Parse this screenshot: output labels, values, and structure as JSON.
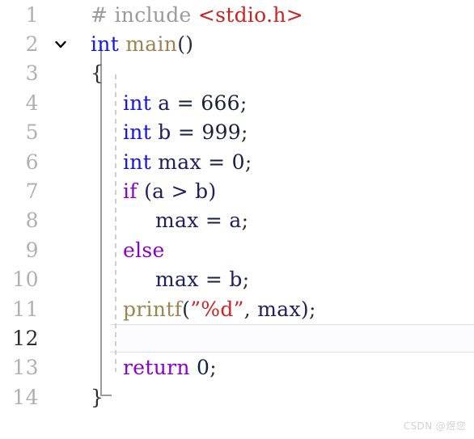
{
  "editor": {
    "language": "c",
    "background_color": "#ffffff",
    "active_line": 12,
    "fold_marker": {
      "line": 2,
      "state": "expanded",
      "icon": "chevron-down-icon"
    },
    "colors": {
      "line_number": "#b0b0b0",
      "line_number_active": "#2b2b38",
      "preprocessor": "#9a9a9a",
      "header_name": "#cc2222",
      "keyword_type": "#1414e6",
      "keyword_control": "#8b00c8",
      "function_name": "#9c8452",
      "identifier": "#1e2060",
      "number": "#16213e",
      "string": "#cc2222",
      "punctuation": "#2b2b38",
      "fold_line": "#9b9b9b",
      "indent_guide": "#cfcfcf",
      "active_line_border": "#dcdce6"
    },
    "lines": [
      {
        "number": "1",
        "indent": 0,
        "tokens": [
          {
            "text": "# include ",
            "type": "pre"
          },
          {
            "text": "<stdio.h>",
            "type": "header"
          }
        ]
      },
      {
        "number": "2",
        "indent": 0,
        "tokens": [
          {
            "text": "int",
            "type": "kw"
          },
          {
            "text": " ",
            "type": "punc"
          },
          {
            "text": "main",
            "type": "fn"
          },
          {
            "text": "()",
            "type": "punc"
          }
        ]
      },
      {
        "number": "3",
        "indent": 0,
        "tokens": [
          {
            "text": "{",
            "type": "punc"
          }
        ]
      },
      {
        "number": "4",
        "indent": 1,
        "tokens": [
          {
            "text": "int",
            "type": "kw"
          },
          {
            "text": " ",
            "type": "punc"
          },
          {
            "text": "a",
            "type": "ident"
          },
          {
            "text": " ",
            "type": "punc"
          },
          {
            "text": "=",
            "type": "op"
          },
          {
            "text": " ",
            "type": "punc"
          },
          {
            "text": "666",
            "type": "num"
          },
          {
            "text": ";",
            "type": "punc"
          }
        ]
      },
      {
        "number": "5",
        "indent": 1,
        "tokens": [
          {
            "text": "int",
            "type": "kw"
          },
          {
            "text": " ",
            "type": "punc"
          },
          {
            "text": "b",
            "type": "ident"
          },
          {
            "text": " ",
            "type": "punc"
          },
          {
            "text": "=",
            "type": "op"
          },
          {
            "text": " ",
            "type": "punc"
          },
          {
            "text": "999",
            "type": "num"
          },
          {
            "text": ";",
            "type": "punc"
          }
        ]
      },
      {
        "number": "6",
        "indent": 1,
        "tokens": [
          {
            "text": "int",
            "type": "kw"
          },
          {
            "text": " ",
            "type": "punc"
          },
          {
            "text": "max",
            "type": "ident"
          },
          {
            "text": " ",
            "type": "punc"
          },
          {
            "text": "=",
            "type": "op"
          },
          {
            "text": " ",
            "type": "punc"
          },
          {
            "text": "0",
            "type": "num"
          },
          {
            "text": ";",
            "type": "punc"
          }
        ]
      },
      {
        "number": "7",
        "indent": 1,
        "tokens": [
          {
            "text": "if",
            "type": "ctrl"
          },
          {
            "text": " ",
            "type": "punc"
          },
          {
            "text": "(",
            "type": "ident"
          },
          {
            "text": "a",
            "type": "ident"
          },
          {
            "text": " ",
            "type": "punc"
          },
          {
            "text": ">",
            "type": "ident"
          },
          {
            "text": " ",
            "type": "punc"
          },
          {
            "text": "b",
            "type": "ident"
          },
          {
            "text": ")",
            "type": "ident"
          }
        ]
      },
      {
        "number": "8",
        "indent": 2,
        "tokens": [
          {
            "text": "max",
            "type": "ident"
          },
          {
            "text": " ",
            "type": "punc"
          },
          {
            "text": "=",
            "type": "op"
          },
          {
            "text": " ",
            "type": "punc"
          },
          {
            "text": "a",
            "type": "ident"
          },
          {
            "text": ";",
            "type": "punc"
          }
        ]
      },
      {
        "number": "9",
        "indent": 1,
        "tokens": [
          {
            "text": "else",
            "type": "ctrl"
          }
        ]
      },
      {
        "number": "10",
        "indent": 2,
        "tokens": [
          {
            "text": "max",
            "type": "ident"
          },
          {
            "text": " ",
            "type": "punc"
          },
          {
            "text": "=",
            "type": "op"
          },
          {
            "text": " ",
            "type": "punc"
          },
          {
            "text": "b",
            "type": "ident"
          },
          {
            "text": ";",
            "type": "punc"
          }
        ]
      },
      {
        "number": "11",
        "indent": 1,
        "tokens": [
          {
            "text": "printf",
            "type": "fn"
          },
          {
            "text": "(",
            "type": "punc"
          },
          {
            "text": "”%d”",
            "type": "str"
          },
          {
            "text": ",",
            "type": "punc"
          },
          {
            "text": " ",
            "type": "punc"
          },
          {
            "text": "max",
            "type": "ident"
          },
          {
            "text": ")",
            "type": "ident"
          },
          {
            "text": ";",
            "type": "punc"
          }
        ]
      },
      {
        "number": "12",
        "indent": 1,
        "tokens": []
      },
      {
        "number": "13",
        "indent": 1,
        "tokens": [
          {
            "text": "return",
            "type": "ctrl"
          },
          {
            "text": " ",
            "type": "punc"
          },
          {
            "text": "0",
            "type": "num"
          },
          {
            "text": ";",
            "type": "punc"
          }
        ]
      },
      {
        "number": "14",
        "indent": 0,
        "tokens": [
          {
            "text": "}",
            "type": "punc"
          }
        ]
      }
    ]
  },
  "watermark": {
    "text": "CSDN @煜您"
  }
}
